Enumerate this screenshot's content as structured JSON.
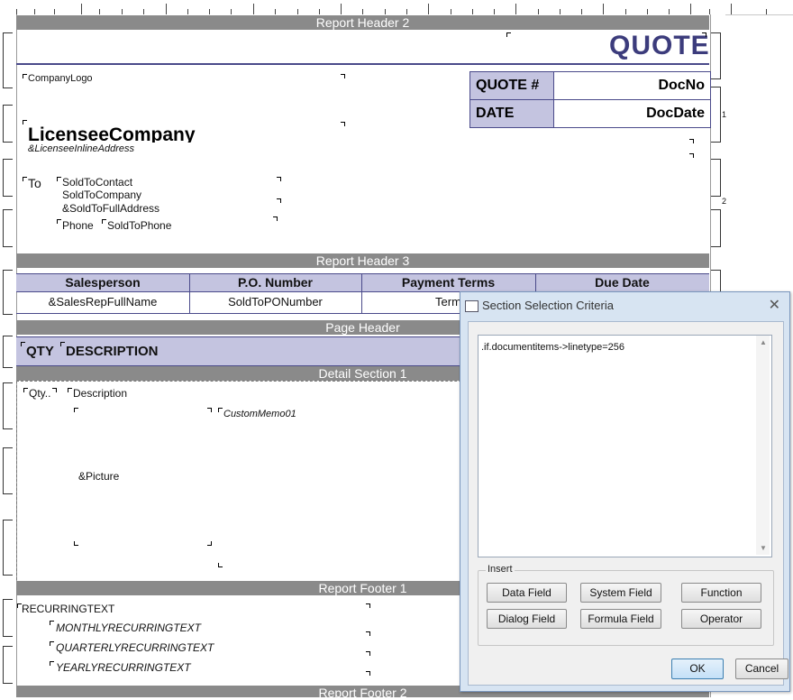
{
  "report": {
    "bands": {
      "report_header_2": "Report Header 2",
      "report_header_3": "Report Header 3",
      "page_header": "Page Header",
      "detail_section_1": "Detail Section 1",
      "report_footer_1": "Report Footer 1",
      "report_footer_2": "Report Footer 2"
    },
    "header2": {
      "title": "QUOTE",
      "company_logo": "CompanyLogo",
      "quote_label": "QUOTE #",
      "quote_value": "DocNo",
      "date_label": "DATE",
      "date_value": "DocDate",
      "licensee_company": "LicenseeCompany",
      "licensee_address": "&LicenseeInlineAddress",
      "to_label": "To",
      "sold_to_contact": "SoldToContact",
      "sold_to_company": "SoldToCompany",
      "sold_to_address": "&SoldToFullAddress",
      "phone_label": "Phone",
      "sold_to_phone": "SoldToPhone"
    },
    "header3": {
      "columns": [
        "Salesperson",
        "P.O. Number",
        "Payment Terms",
        "Due Date"
      ],
      "values": [
        "&SalesRepFullName",
        "SoldToPONumber",
        "Term",
        ""
      ]
    },
    "page_header": {
      "qty": "QTY",
      "description": "DESCRIPTION"
    },
    "detail": {
      "qty": "Qty..",
      "description": "Description",
      "custom_memo": "CustomMemo01",
      "picture": "&Picture"
    },
    "footer1": {
      "recurring": "RECURRINGTEXT",
      "monthly": "MONTHLYRECURRINGTEXT",
      "quarterly": "QUARTERLYRECURRINGTEXT",
      "yearly": "YEARLYRECURRINGTEXT"
    },
    "ruler_marks": [
      "1",
      "2"
    ]
  },
  "dialog": {
    "title": "Section Selection Criteria",
    "close_glyph": "✕",
    "criteria_text": ".if.documentitems->linetype=256",
    "insert_group_label": "Insert",
    "buttons": {
      "data_field": "Data Field",
      "system_field": "System Field",
      "function": "Function",
      "dialog_field": "Dialog Field",
      "formula_field": "Formula Field",
      "operator": "Operator",
      "ok": "OK",
      "cancel": "Cancel"
    }
  },
  "colors": {
    "band_gray": "#8a8a8a",
    "header_fill": "#c4c4e0",
    "title_navy": "#3c3c7c",
    "dialog_frame": "#d7e4f2"
  }
}
